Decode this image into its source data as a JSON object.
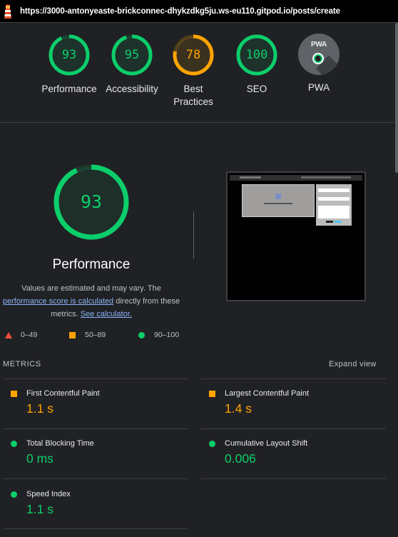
{
  "browser": {
    "url": "https://3000-antonyeaste-brickconnec-dhykzdkg5ju.ws-eu110.gitpod.io/posts/create",
    "logo_icon": "lighthouse-icon"
  },
  "categories": [
    {
      "label": "Performance",
      "score": "93",
      "fraction": 0.93,
      "color": "#0cce6b"
    },
    {
      "label": "Accessibility",
      "score": "95",
      "fraction": 0.95,
      "color": "#0cce6b"
    },
    {
      "label": "Best\nPractices",
      "score": "78",
      "fraction": 0.78,
      "color": "#ffa400"
    },
    {
      "label": "SEO",
      "score": "100",
      "fraction": 1.0,
      "color": "#0cce6b"
    },
    {
      "label": "PWA",
      "badge_text": "PWA",
      "icon": "pwa-badge-icon"
    }
  ],
  "performance": {
    "score": "93",
    "fraction": 0.93,
    "title": "Performance",
    "note_prefix": "Values are estimated and may vary. The",
    "note_link": "performance score is calculated",
    "note_mid": "directly from these",
    "note_metrics": "metrics.",
    "note_calc_link": "See calculator."
  },
  "legend": [
    {
      "icon": "fail-triangle-icon",
      "range": "0–49"
    },
    {
      "icon": "average-square-icon",
      "range": "50–89"
    },
    {
      "icon": "pass-circle-icon",
      "range": "90–100"
    }
  ],
  "metrics": {
    "header": "METRICS",
    "expand_label": "Expand view",
    "items": [
      {
        "name": "First Contentful Paint",
        "value": "1.1 s",
        "status": "average"
      },
      {
        "name": "Largest Contentful Paint",
        "value": "1.4 s",
        "status": "average"
      },
      {
        "name": "Total Blocking Time",
        "value": "0 ms",
        "status": "pass"
      },
      {
        "name": "Cumulative Layout Shift",
        "value": "0.006",
        "status": "pass"
      },
      {
        "name": "Speed Index",
        "value": "1.1 s",
        "status": "pass"
      }
    ]
  },
  "colors": {
    "pass": "#0cce6b",
    "average": "#ffa400",
    "fail": "#ff4e42",
    "background": "#202124"
  }
}
